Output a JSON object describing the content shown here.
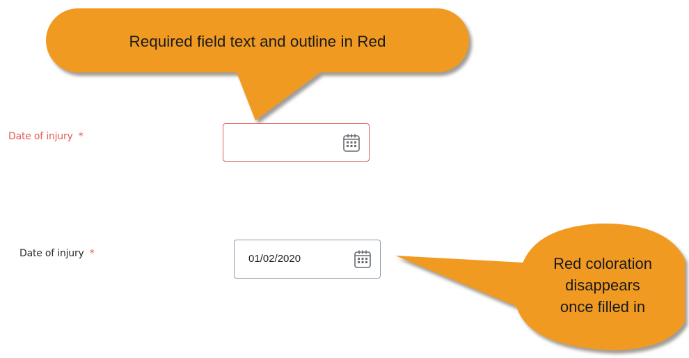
{
  "callouts": {
    "top": "Required field text and outline in Red",
    "right": "Red coloration\ndisappears\nonce filled in",
    "fill_color": "#f19a22",
    "shadow_color": "#8f8a84"
  },
  "fields": [
    {
      "label": "Date of injury",
      "required_marker": "*",
      "value": "",
      "state": "error",
      "label_color": "#e25b52",
      "border_color": "#e25b52",
      "icon": "calendar-icon"
    },
    {
      "label": "Date of injury",
      "required_marker": "*",
      "value": "01/02/2020",
      "state": "filled",
      "label_color": "#2b2b2b",
      "border_color": "#8a9bb0",
      "icon": "calendar-icon"
    }
  ]
}
